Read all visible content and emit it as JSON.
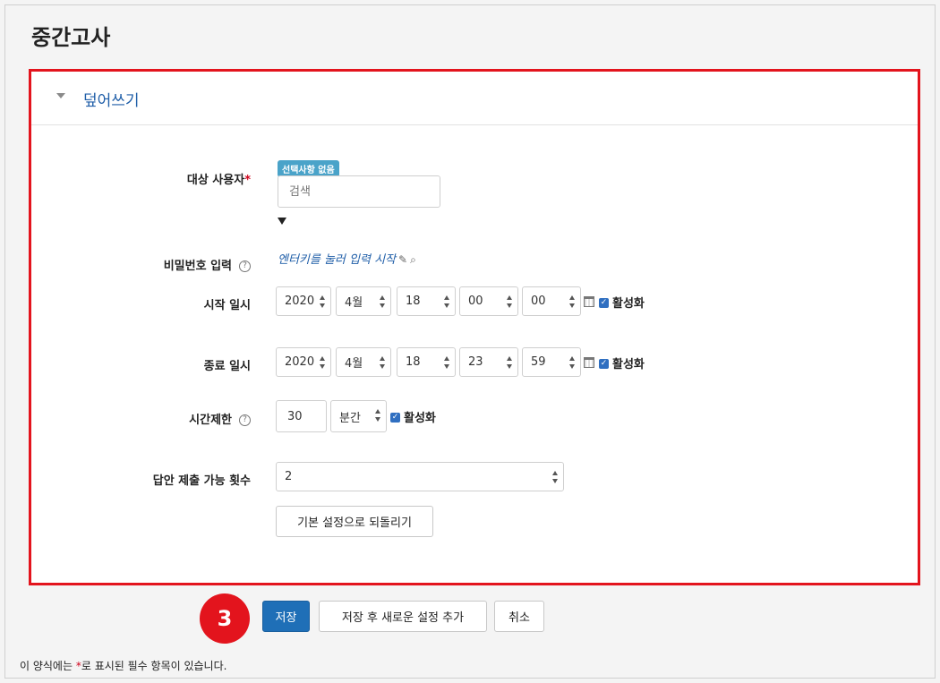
{
  "page": {
    "title": "중간고사"
  },
  "section": {
    "title": "덮어쓰기"
  },
  "form": {
    "target_user": {
      "label": "대상 사용자",
      "required_mark": "*",
      "badge": "선택사항 없음",
      "search_placeholder": "검색"
    },
    "password": {
      "label": "비밀번호 입력",
      "help": "?",
      "link_text": "엔터키를 눌러 입력 시작"
    },
    "start": {
      "label": "시작 일시",
      "year": "2020",
      "month": "4월",
      "day": "18",
      "hour": "00",
      "minute": "00",
      "enable_label": "활성화"
    },
    "end": {
      "label": "종료 일시",
      "year": "2020",
      "month": "4월",
      "day": "18",
      "hour": "23",
      "minute": "59",
      "enable_label": "활성화"
    },
    "time_limit": {
      "label": "시간제한",
      "help": "?",
      "value": "30",
      "unit": "분간",
      "enable_label": "활성화"
    },
    "attempts": {
      "label": "답안 제출 가능 횟수",
      "value": "2"
    },
    "reset_button": "기본 설정으로 되돌리기"
  },
  "actions": {
    "step_number": "3",
    "save": "저장",
    "save_and_add": "저장 후 새로운 설정 추가",
    "cancel": "취소"
  },
  "footer": {
    "note_prefix": "이 양식에는 ",
    "required_mark": "*",
    "note_suffix": "로 표시된 필수 항목이 있습니다."
  },
  "colors": {
    "highlight": "#e3141d",
    "accent": "#1f5ea8",
    "primary_button": "#1f6fb7"
  }
}
